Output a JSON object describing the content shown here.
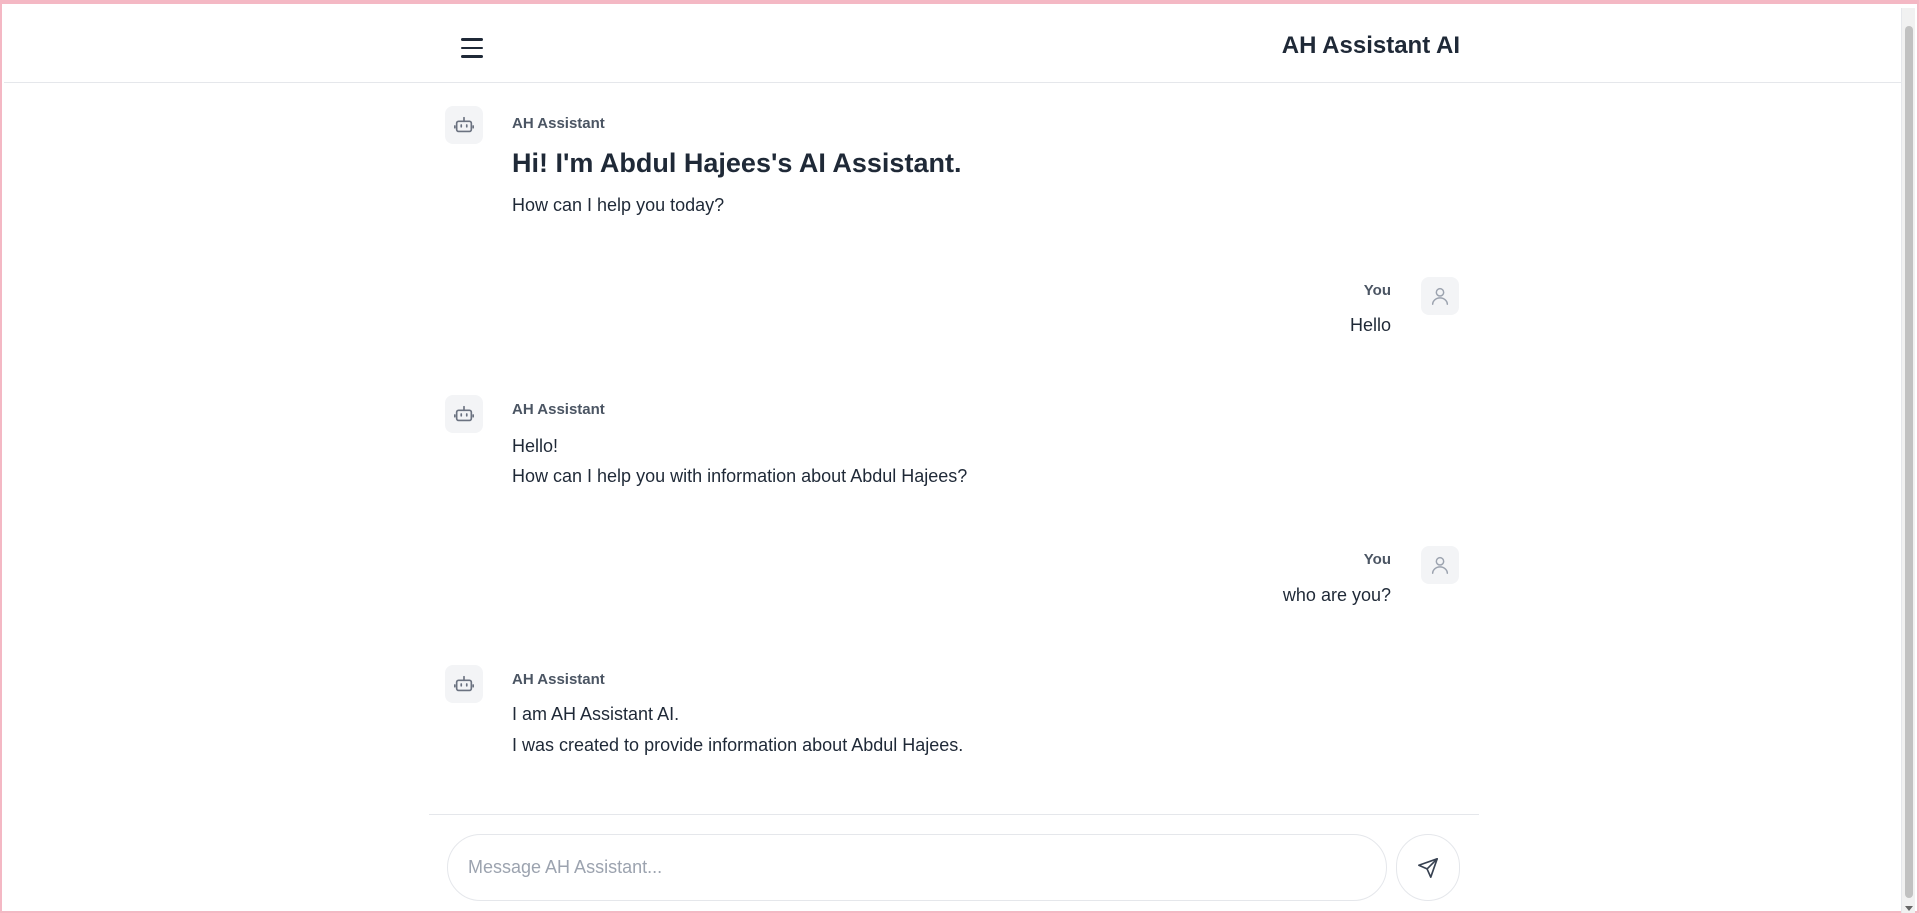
{
  "header": {
    "menu_icon": "hamburger-menu-icon",
    "title": "AH Assistant AI"
  },
  "messages": [
    {
      "role": "assistant",
      "name": "AH Assistant",
      "avatar_icon": "robot-icon",
      "heading": "Hi! I'm Abdul Hajees's AI Assistant.",
      "lines": [
        "How can I help you today?"
      ]
    },
    {
      "role": "user",
      "name": "You",
      "avatar_icon": "user-icon",
      "lines": [
        "Hello"
      ]
    },
    {
      "role": "assistant",
      "name": "AH Assistant",
      "avatar_icon": "robot-icon",
      "lines": [
        "Hello!",
        "How can I help you with information about Abdul Hajees?"
      ]
    },
    {
      "role": "user",
      "name": "You",
      "avatar_icon": "user-icon",
      "lines": [
        "who are you?"
      ]
    },
    {
      "role": "assistant",
      "name": "AH Assistant",
      "avatar_icon": "robot-icon",
      "lines": [
        "I am AH Assistant AI.",
        "I was created to provide information about Abdul Hajees."
      ]
    }
  ],
  "composer": {
    "placeholder": "Message AH Assistant...",
    "value": "",
    "send_icon": "send-icon"
  },
  "colors": {
    "accent_border": "#f4b8c4",
    "text_primary": "#1f2937",
    "text_muted": "#4b5563",
    "avatar_bg": "#f3f4f6"
  }
}
